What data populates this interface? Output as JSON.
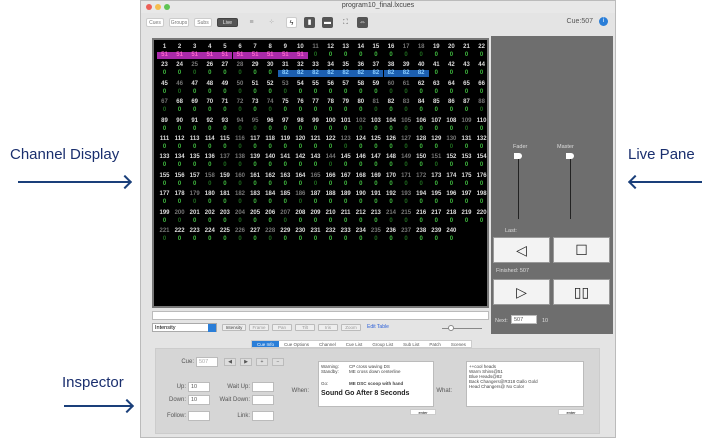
{
  "annotations": {
    "channel_display": "Channel Display",
    "live_pane": "Live Pane",
    "inspector": "Inspector"
  },
  "window": {
    "title": "program10_final.lxcues",
    "cue_label": "Cue:507"
  },
  "toolbar": {
    "modes": [
      "Cues",
      "Groups",
      "Subs",
      "Live"
    ],
    "active_mode": "Live",
    "icons": [
      "list-icon",
      "grid-icon",
      "flash-icon",
      "record-icon",
      "dimmer-icon",
      "fullscreen-icon",
      "ab-icon"
    ]
  },
  "channel_display": {
    "channel_count": 240,
    "columns": 22,
    "default_level": "0",
    "levels": {
      "1": "51",
      "2": "51",
      "3": "51",
      "4": "51",
      "5": "51",
      "6": "51",
      "7": "51",
      "8": "51",
      "9": "51",
      "10": "51",
      "31": "82",
      "32": "82",
      "33": "82",
      "34": "82",
      "35": "82",
      "36": "82",
      "37": "82",
      "38": "82",
      "39": "82",
      "40": "82"
    },
    "colors": {
      "sub": "#a92aa9",
      "group": "#1c5fb0",
      "zero": "#3fb93f"
    }
  },
  "command_bar": {
    "value": ""
  },
  "bottom_bar": {
    "select_value": "Intensity",
    "buttons": [
      "Intensity",
      "Frame",
      "Pan",
      "Tilt",
      "Iris",
      "Zoom"
    ],
    "link": "Edit Table"
  },
  "live_pane": {
    "fader_label": "Fader",
    "master_label": "Master",
    "last_label": "Last:",
    "finished_label": "Finished: 507",
    "next_label": "Next:",
    "next_value": "507",
    "next_time": "10"
  },
  "inspector": {
    "tabs": [
      "Cue Info",
      "Cue Options",
      "Channel",
      "Cue List",
      "Group List",
      "Sub List",
      "Patch",
      "Scenes"
    ],
    "active_tab": "Cue Info",
    "cue_label": "Cue:",
    "cue_value": "507",
    "up_label": "Up:",
    "up_value": "10",
    "down_label": "Down:",
    "down_value": "10",
    "follow_label": "Follow:",
    "follow_value": "",
    "wait_up_label": "Wait Up:",
    "wait_down_label": "Wait Down:",
    "link_label": "Link:",
    "when_label": "When:",
    "what_label": "What:",
    "when": {
      "warning_label": "Warning:",
      "warning": "CP cross waving DS",
      "standby_label": "Standby:",
      "standby": "ME cross down centerline",
      "go_label": "Go:",
      "go": "ME DSC scoop with hand",
      "note": "Sound Go After 8 Seconds"
    },
    "what_lines": [
      "++cool heads",
      "Warm Shins@51",
      "Blue Heads@82",
      "Back Changers@R318 Gallo Gold",
      "Head Changers@ No Color"
    ],
    "enter_label": "enter"
  }
}
